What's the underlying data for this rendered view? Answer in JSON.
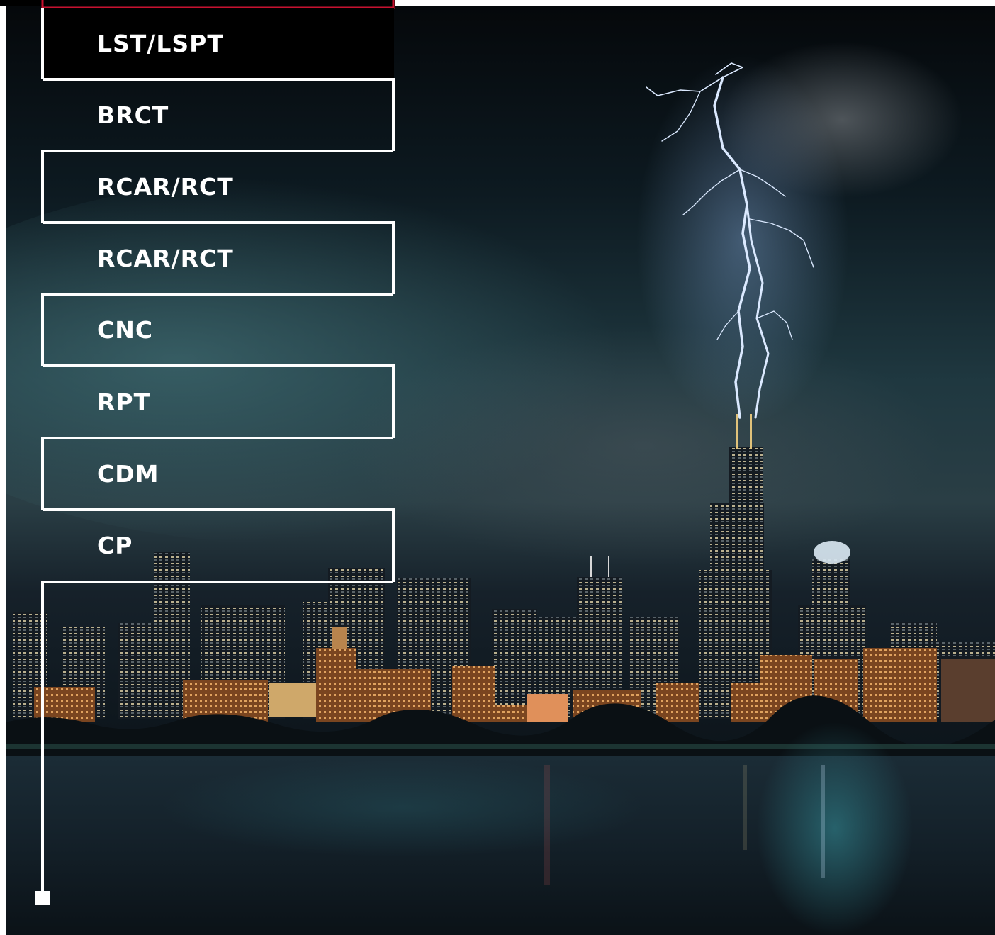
{
  "menu": {
    "items": [
      {
        "label": "LST/LSPT"
      },
      {
        "label": "BRCT"
      },
      {
        "label": "RCAR/RCT"
      },
      {
        "label": "RCAR/RCT"
      },
      {
        "label": "CNC"
      },
      {
        "label": "RPT"
      },
      {
        "label": "CDM"
      },
      {
        "label": "CP"
      }
    ]
  },
  "colors": {
    "outline": "#ffffff",
    "accent_top_border": "#c8102e",
    "label_text": "#ffffff"
  },
  "background_photo": {
    "icons": [
      "lightning-bolt",
      "city-skyline",
      "lake-water"
    ]
  }
}
